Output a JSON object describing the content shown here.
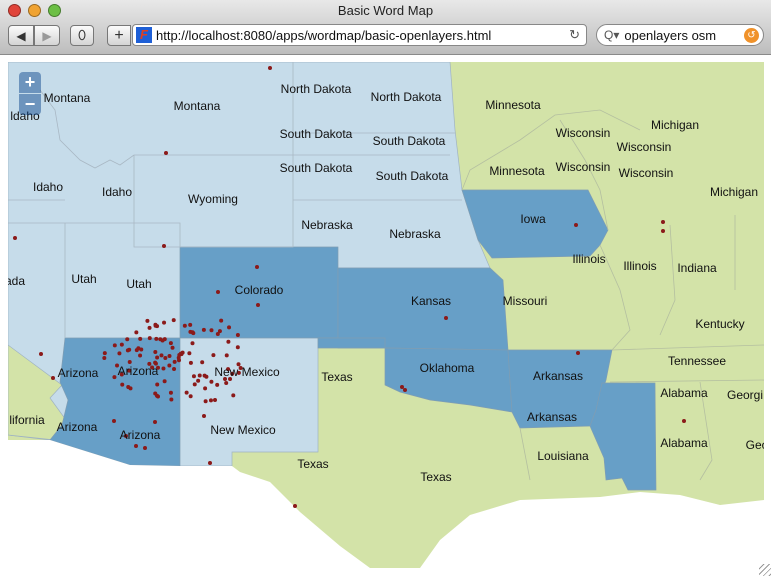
{
  "window": {
    "title": "Basic Word Map"
  },
  "toolbar": {
    "back_icon": "◀",
    "forward_icon": "▶",
    "shield_icon": "⬯",
    "add_label": "+",
    "url": "http://localhost:8080/apps/wordmap/basic-openlayers.html",
    "reload_icon": "↻",
    "search_value": "openlayers osm",
    "search_icon": "Q▾",
    "search_clear_icon": "↺"
  },
  "map": {
    "zoom_in": "+",
    "zoom_out": "−",
    "colors": {
      "light": "#c6dcea",
      "dark": "#679fc7",
      "green": "#d3e3a8",
      "marker": "#8b1a1a"
    },
    "labels": [
      "Montana",
      "ldaho",
      "Montana",
      "North Dakota",
      "North Dakota",
      "Minnesota",
      "Wisconsin",
      "Michigan",
      "Wisconsin",
      "Wisconsin",
      "Michigan",
      "South Dakota",
      "South Dakota",
      "Minnesota",
      "Wisconsin",
      "South Dakota",
      "South Dakota",
      "Idaho",
      "Idaho",
      "Wyoming",
      "Nebraska",
      "Nebraska",
      "Iowa",
      "Illinois",
      "Illinois",
      "Indiana",
      "ada",
      "Utah",
      "Utah",
      "Colorado",
      "Kansas",
      "Missouri",
      "Kentucky",
      "Tennessee",
      "Arizona",
      "Arizona",
      "New Mexico",
      "Texas",
      "Oklahoma",
      "Arkansas",
      "Alabama",
      "Georgi",
      "lifornia",
      "Arizona",
      "Arizona",
      "New Mexico",
      "Arkansas",
      "Alabama",
      "Geo",
      "Louisiana",
      "Texas",
      "Texas"
    ]
  }
}
